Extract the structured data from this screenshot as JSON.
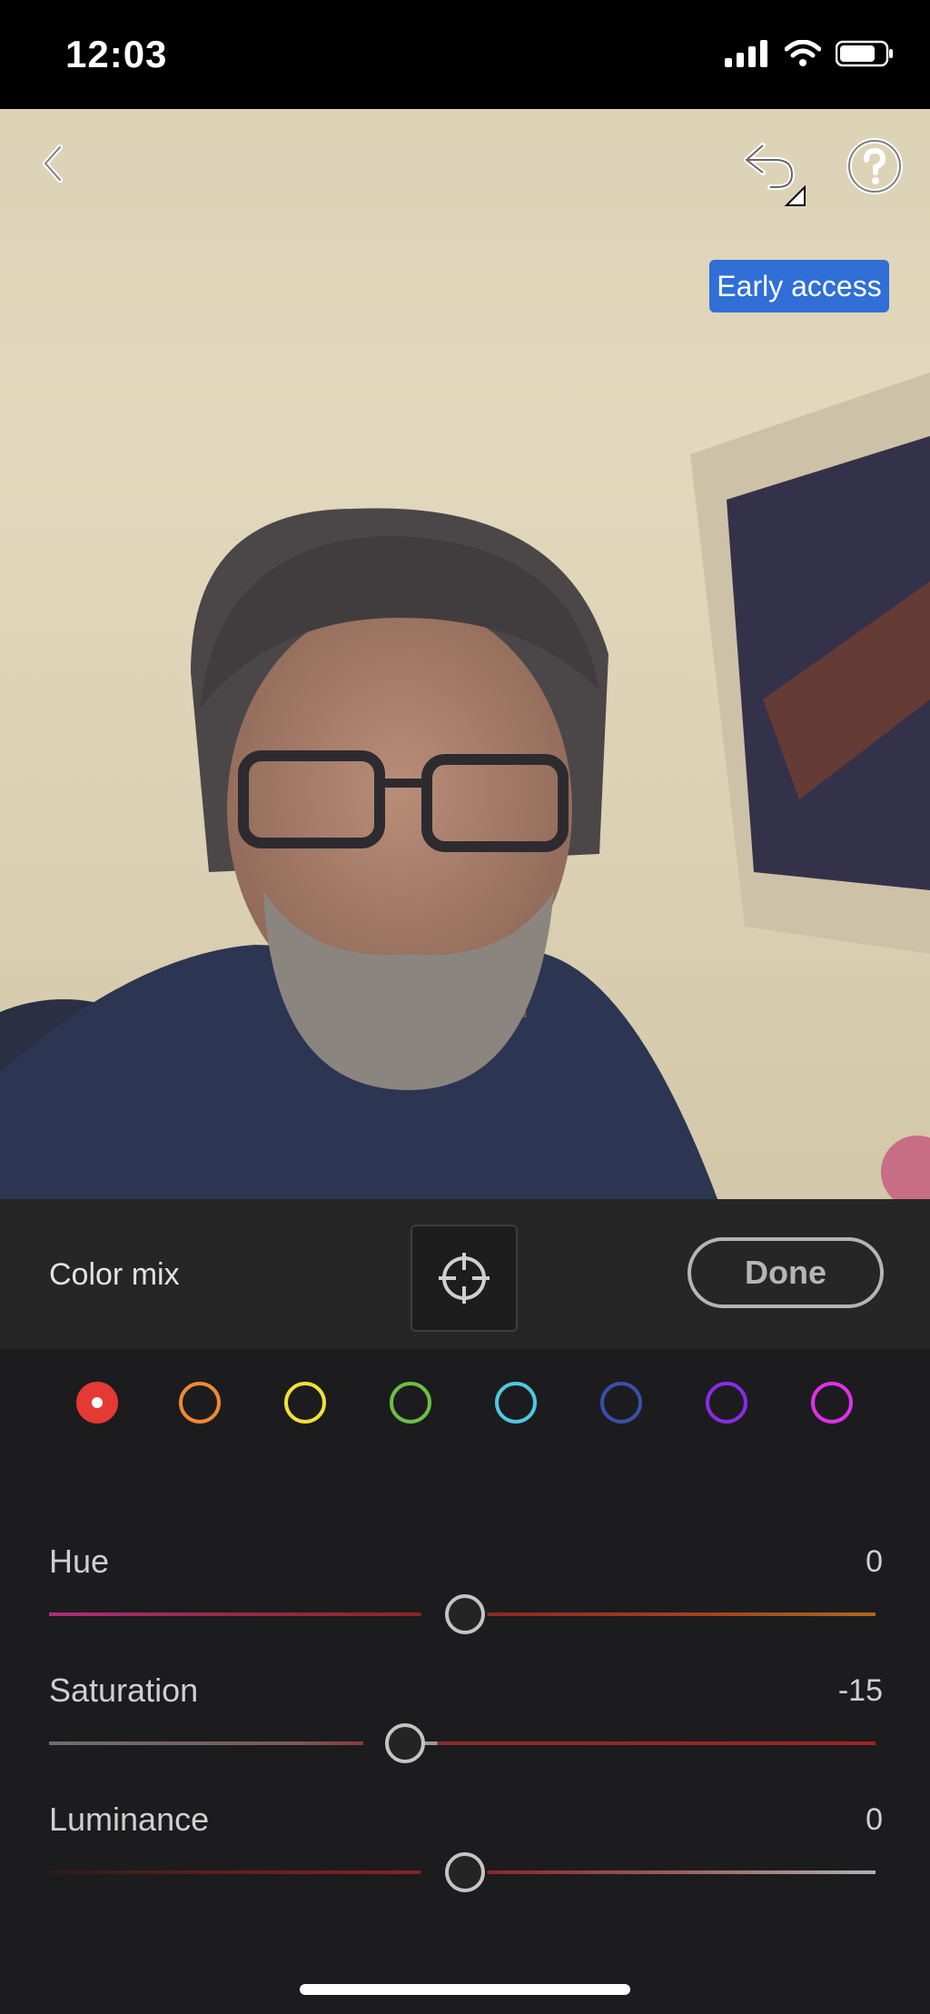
{
  "status_bar": {
    "time": "12:03"
  },
  "photo": {
    "badge": "Early access"
  },
  "toolbar": {
    "title": "Color mix",
    "done_label": "Done"
  },
  "swatches": [
    {
      "name": "red",
      "color": "#e53935",
      "selected": true
    },
    {
      "name": "orange",
      "color": "#f08a30",
      "selected": false
    },
    {
      "name": "yellow",
      "color": "#f4e03a",
      "selected": false
    },
    {
      "name": "green",
      "color": "#6cbf45",
      "selected": false
    },
    {
      "name": "aqua",
      "color": "#4fc8e0",
      "selected": false
    },
    {
      "name": "blue",
      "color": "#3a4fa8",
      "selected": false
    },
    {
      "name": "purple",
      "color": "#8a2be8",
      "selected": false
    },
    {
      "name": "magenta",
      "color": "#e030e8",
      "selected": false
    }
  ],
  "sliders": [
    {
      "label": "Hue",
      "value": "0"
    },
    {
      "label": "Saturation",
      "value": "-15"
    },
    {
      "label": "Luminance",
      "value": "0"
    }
  ],
  "icons": [
    "back-icon",
    "undo-icon",
    "help-icon",
    "target-icon",
    "signal-icon",
    "wifi-icon",
    "battery-icon"
  ]
}
